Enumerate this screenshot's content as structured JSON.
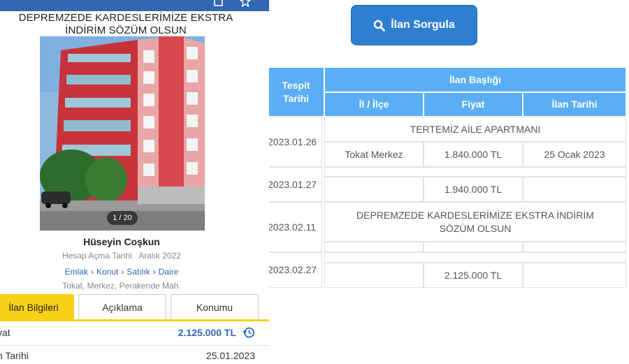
{
  "listing": {
    "title": "DEPREMZEDE KARDESLERİMİZE EKSTRA İNDİRİM SÖZÜM OLSUN",
    "photo_counter": "1 / 20",
    "seller_name": "Hüseyin Coşkun",
    "account_label": "Hesap Açma Tarihi",
    "account_date": "Aralık 2022",
    "breadcrumb": [
      "Emlak",
      "Konut",
      "Satılık",
      "Daire"
    ],
    "breadcrumb_separator": "›",
    "location": "Tokat, Merkez, Perakende Mah.",
    "tabs": [
      {
        "label": "İlan Bilgileri",
        "active": true
      },
      {
        "label": "Açıklama",
        "active": false
      },
      {
        "label": "Konumu",
        "active": false
      }
    ],
    "details": [
      {
        "label": "yat",
        "value": "2.125.000 TL"
      },
      {
        "label": "n Tarihi",
        "value": "25.01.2023"
      }
    ],
    "colors": {
      "brand_blue": "#2f68b3",
      "tab_yellow": "#f7d117",
      "building_red": "#c8323a"
    },
    "icons": {
      "history": "history-icon",
      "header_left": "share-icon",
      "header_right": "star-icon"
    }
  },
  "query": {
    "button_label": "İlan Sorgula",
    "icon": "search-icon",
    "color": "#2f7fd0"
  },
  "table": {
    "header": {
      "tespit": "Tespit Tarihi",
      "ilan_basligi": "İlan Başlığı",
      "il_ilce": "İl / İlçe",
      "fiyat": "Fiyat",
      "ilan_tarihi": "İlan Tarihi",
      "color": "#5aaef5"
    },
    "rows": [
      {
        "date": "2023.01.26",
        "title": "TERTEMİZ AİLE APARTMANI",
        "location": "Tokat Merkez",
        "price": "1.840.000 TL",
        "listing_date": "25 Ocak 2023"
      },
      {
        "date": "2023.01.27",
        "title": "",
        "location": "",
        "price": "1.940.000 TL",
        "listing_date": ""
      },
      {
        "date": "2023.02.11",
        "title": "DEPREMZEDE KARDESLERİMİZE EKSTRA İNDİRİM SÖZÜM OLSUN",
        "location": "",
        "price": "",
        "listing_date": ""
      },
      {
        "date": "2023.02.27",
        "title": "",
        "location": "",
        "price": "2.125.000 TL",
        "listing_date": ""
      }
    ]
  }
}
